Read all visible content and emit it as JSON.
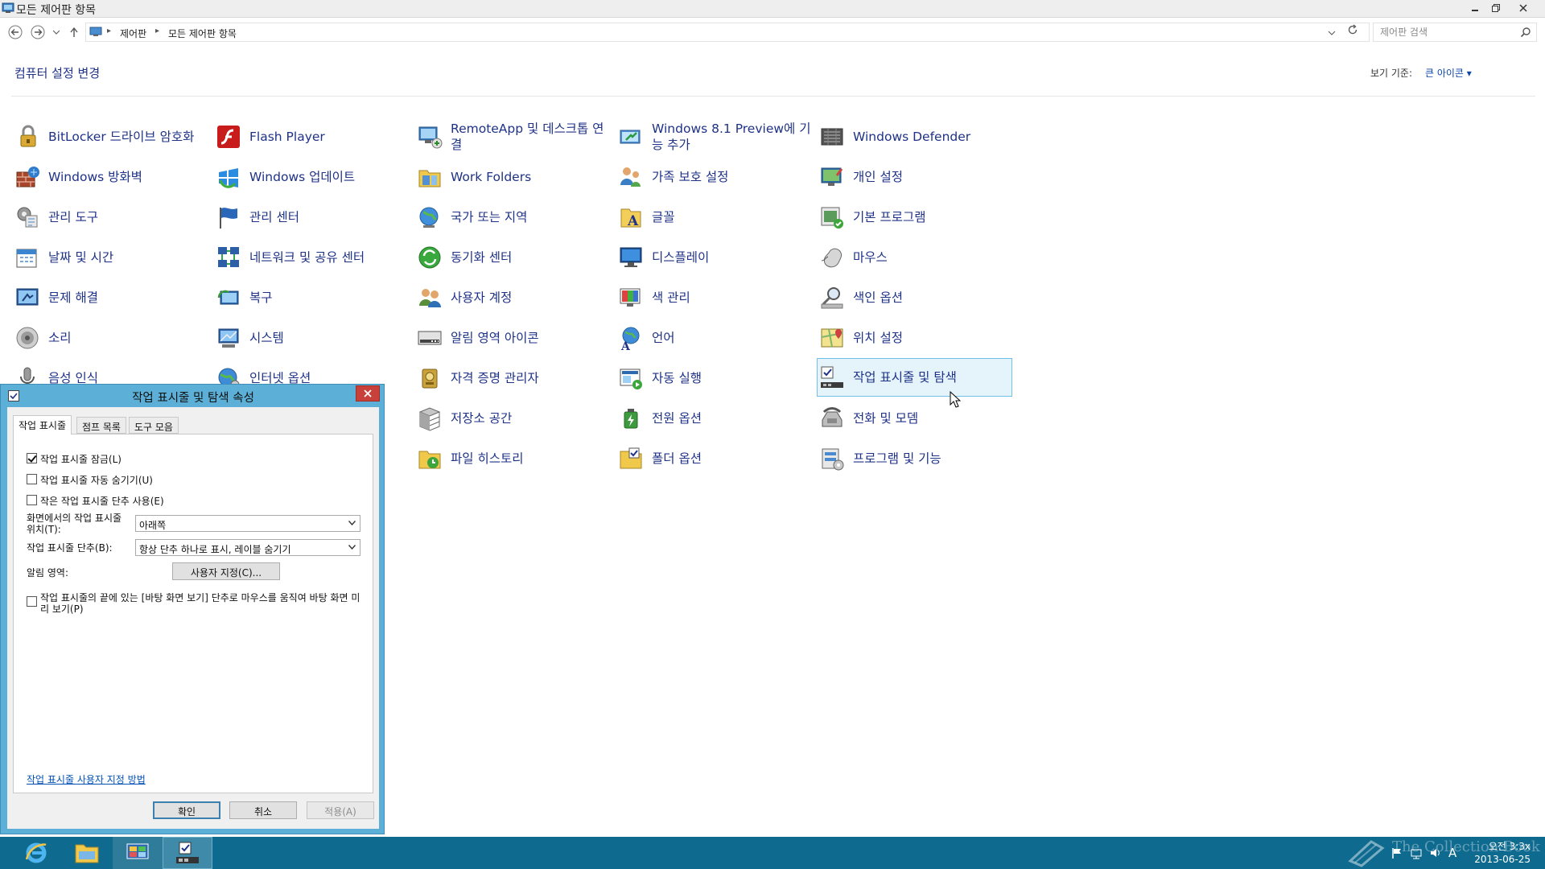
{
  "window": {
    "title": "모든 제어판 항목"
  },
  "address": {
    "crumbs": [
      "제어판",
      "모든 제어판 항목"
    ],
    "search_placeholder": "제어판 검색"
  },
  "header": {
    "title": "컴퓨터 설정 변경",
    "view_by_label": "보기 기준:",
    "view_by_value": "큰 아이콘 ▾"
  },
  "items": [
    {
      "label": "BitLocker 드라이브 암호화",
      "icon": "bitlocker-icon"
    },
    {
      "label": "Flash Player",
      "icon": "flash-player-icon"
    },
    {
      "label": "RemoteApp 및 데스크톱 연결",
      "icon": "remoteapp-icon"
    },
    {
      "label": "Windows 8.1 Preview에 기능 추가",
      "icon": "add-features-icon"
    },
    {
      "label": "Windows Defender",
      "icon": "windows-defender-icon"
    },
    {
      "label": "Windows 방화벽",
      "icon": "firewall-icon"
    },
    {
      "label": "Windows 업데이트",
      "icon": "windows-update-icon"
    },
    {
      "label": "Work Folders",
      "icon": "work-folders-icon"
    },
    {
      "label": "가족 보호 설정",
      "icon": "family-safety-icon"
    },
    {
      "label": "개인 설정",
      "icon": "personalization-icon"
    },
    {
      "label": "관리 도구",
      "icon": "admin-tools-icon"
    },
    {
      "label": "관리 센터",
      "icon": "action-center-icon"
    },
    {
      "label": "국가 또는 지역",
      "icon": "region-icon"
    },
    {
      "label": "글꼴",
      "icon": "fonts-icon"
    },
    {
      "label": "기본 프로그램",
      "icon": "default-programs-icon"
    },
    {
      "label": "날짜 및 시간",
      "icon": "date-time-icon"
    },
    {
      "label": "네트워크 및 공유 센터",
      "icon": "network-center-icon"
    },
    {
      "label": "동기화 센터",
      "icon": "sync-center-icon"
    },
    {
      "label": "디스플레이",
      "icon": "display-icon"
    },
    {
      "label": "마우스",
      "icon": "mouse-icon"
    },
    {
      "label": "문제 해결",
      "icon": "troubleshooting-icon"
    },
    {
      "label": "복구",
      "icon": "recovery-icon"
    },
    {
      "label": "사용자 계정",
      "icon": "user-accounts-icon"
    },
    {
      "label": "색 관리",
      "icon": "color-management-icon"
    },
    {
      "label": "색인 옵션",
      "icon": "indexing-options-icon"
    },
    {
      "label": "소리",
      "icon": "sound-icon"
    },
    {
      "label": "시스템",
      "icon": "system-icon"
    },
    {
      "label": "알림 영역 아이콘",
      "icon": "notification-icons-icon"
    },
    {
      "label": "언어",
      "icon": "language-icon"
    },
    {
      "label": "위치 설정",
      "icon": "location-icon"
    },
    {
      "label": "음성 인식",
      "icon": "speech-recognition-icon"
    },
    {
      "label": "인터넷 옵션",
      "icon": "internet-options-icon"
    },
    {
      "label": "자격 증명 관리자",
      "icon": "credential-manager-icon"
    },
    {
      "label": "자동 실행",
      "icon": "autoplay-icon"
    },
    {
      "label": "작업 표시줄 및 탐색",
      "icon": "taskbar-navigation-icon"
    },
    {
      "label": "저장소 공간",
      "icon": "storage-spaces-icon"
    },
    {
      "label": "전원 옵션",
      "icon": "power-options-icon"
    },
    {
      "label": "전화 및 모뎀",
      "icon": "phone-modem-icon"
    },
    {
      "label": "파일 히스토리",
      "icon": "file-history-icon"
    },
    {
      "label": "폴더 옵션",
      "icon": "folder-options-icon"
    },
    {
      "label": "프로그램 및 기능",
      "icon": "programs-features-icon"
    }
  ],
  "dialog": {
    "title": "작업 표시줄 및 탐색 속성",
    "tabs": [
      "작업 표시줄",
      "점프 목록",
      "도구 모음"
    ],
    "lock_taskbar": "작업 표시줄 잠금(L)",
    "lock_taskbar_checked": true,
    "autohide": "작업 표시줄 자동 숨기기(U)",
    "autohide_checked": false,
    "small_buttons": "작은 작업 표시줄 단추 사용(E)",
    "small_buttons_checked": false,
    "location_label": "화면에서의 작업 표시줄 위치(T):",
    "location_value": "아래쪽",
    "buttons_label": "작업 표시줄 단추(B):",
    "buttons_value": "항상 단추 하나로 표시, 레이블 숨기기",
    "notification_label": "알림 영역:",
    "customize_button": "사용자 지정(C)...",
    "peek": "작업 표시줄의 끝에 있는 [바탕 화면 보기] 단추로 마우스를 움직여 바탕 화면 미리 보기(P)",
    "peek_checked": false,
    "help_link": "작업 표시줄 사용자 지정 방법",
    "ok": "확인",
    "cancel": "취소",
    "apply": "적용(A)"
  },
  "taskbar": {
    "apps": [
      "internet-explorer-icon",
      "file-explorer-icon",
      "control-panel-icon",
      "taskbar-properties-icon"
    ],
    "ime": "A",
    "time": "오전 3:3x",
    "date": "2013-06-25",
    "watermark": "The Collection Book"
  },
  "colors": {
    "link_blue": "#1e3287",
    "highlight_bg": "#e5f3fb",
    "highlight_border": "#70c0e7",
    "dialog_frame": "#5cb0d7",
    "taskbar": "#0e6a8f"
  }
}
